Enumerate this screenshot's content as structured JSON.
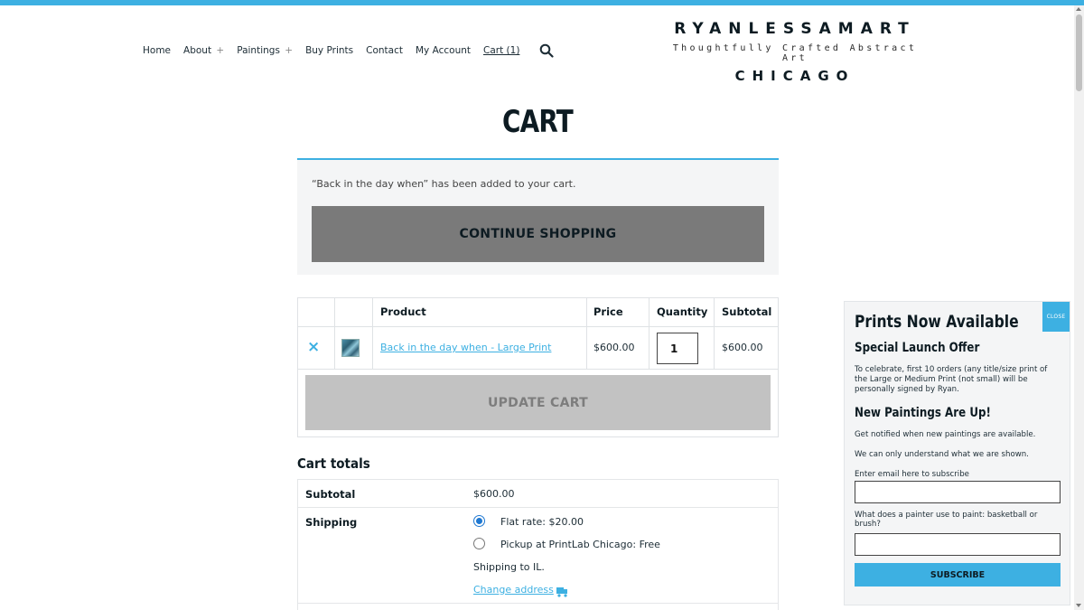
{
  "nav": {
    "items": [
      {
        "label": "Home",
        "plus": ""
      },
      {
        "label": "About",
        "plus": "+"
      },
      {
        "label": "Paintings",
        "plus": "+"
      },
      {
        "label": "Buy Prints",
        "plus": ""
      },
      {
        "label": "Contact",
        "plus": ""
      },
      {
        "label": "My Account",
        "plus": ""
      },
      {
        "label": "Cart (1)",
        "plus": ""
      }
    ],
    "search_icon": "search-icon"
  },
  "brand": {
    "name": "RYANLESSAMART",
    "tagline": "Thoughtfully Crafted Abstract Art",
    "city": "CHICAGO"
  },
  "page": {
    "title": "CART"
  },
  "notice": {
    "message": "“Back in the day when” has been added to your cart.",
    "button": "CONTINUE SHOPPING"
  },
  "cart": {
    "headers": {
      "product": "Product",
      "price": "Price",
      "quantity": "Quantity",
      "subtotal": "Subtotal"
    },
    "row": {
      "remove": "×",
      "product": "Back in the day when - Large Print",
      "price": "$600.00",
      "quantity": "1",
      "subtotal": "$600.00"
    },
    "update_button": "UPDATE CART"
  },
  "totals": {
    "title": "Cart totals",
    "subtotal_label": "Subtotal",
    "subtotal_value": "$600.00",
    "shipping_label": "Shipping",
    "option_flat": "Flat rate: $20.00",
    "option_pickup": "Pickup at PrintLab Chicago: Free",
    "shipping_to": "Shipping to IL.",
    "change_address": "Change address"
  },
  "popup": {
    "close": "CLOSE",
    "title": "Prints Now Available",
    "offer_heading": "Special Launch Offer",
    "offer_text": "To celebrate, first 10 orders (any title/size print of the Large or Medium Print (not small) will be personally signed by Ryan.",
    "new_heading": "New Paintings Are Up!",
    "notify_text": "Get notified when new paintings are available.",
    "quote": "We can only understand what we are shown.",
    "email_label": "Enter email here to subscribe",
    "question_label": "What does a painter use to paint: basketball or brush?",
    "subscribe": "SUBSCRIBE"
  },
  "colors": {
    "accent": "#3db0e2",
    "text": "#1c2c35"
  }
}
